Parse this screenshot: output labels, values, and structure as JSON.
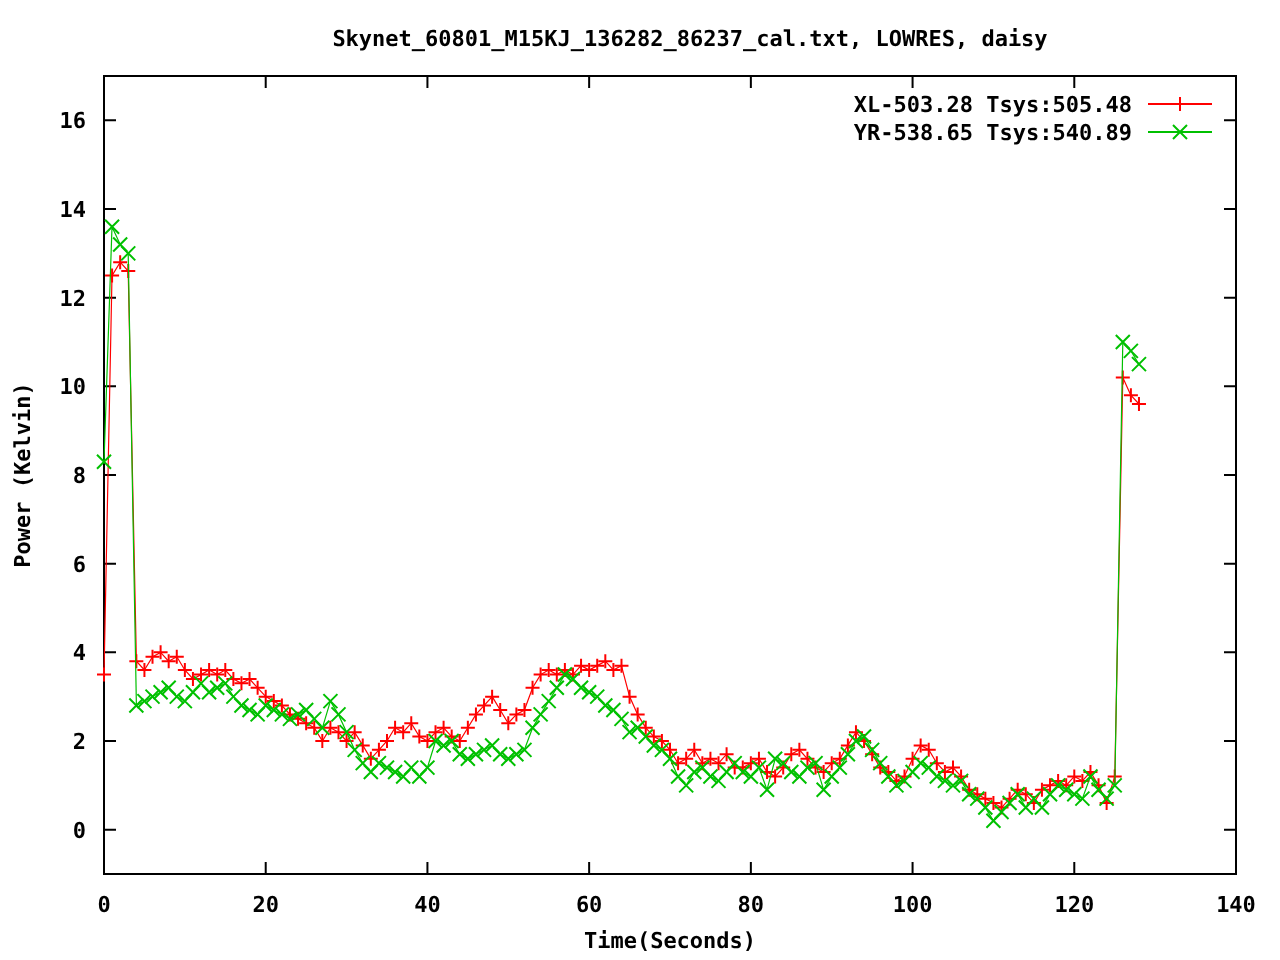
{
  "chart_data": {
    "type": "line",
    "title": "Skynet_60801_M15KJ_136282_86237_cal.txt, LOWRES, daisy",
    "xlabel": "Time(Seconds)",
    "ylabel": "Power (Kelvin)",
    "xlim": [
      0,
      140
    ],
    "ylim": [
      -1,
      17
    ],
    "legend": true,
    "xticks": [
      0,
      20,
      40,
      60,
      80,
      100,
      120,
      140
    ],
    "yticks": [
      0,
      2,
      4,
      6,
      8,
      10,
      12,
      14,
      16
    ],
    "x": [
      0,
      1,
      2,
      3,
      4,
      5,
      6,
      7,
      8,
      9,
      10,
      11,
      12,
      13,
      14,
      15,
      16,
      17,
      18,
      19,
      20,
      21,
      22,
      23,
      24,
      25,
      26,
      27,
      28,
      29,
      30,
      31,
      32,
      33,
      34,
      35,
      36,
      37,
      38,
      39,
      40,
      41,
      42,
      43,
      44,
      45,
      46,
      47,
      48,
      49,
      50,
      51,
      52,
      53,
      54,
      55,
      56,
      57,
      58,
      59,
      60,
      61,
      62,
      63,
      64,
      65,
      66,
      67,
      68,
      69,
      70,
      71,
      72,
      73,
      74,
      75,
      76,
      77,
      78,
      79,
      80,
      81,
      82,
      83,
      84,
      85,
      86,
      87,
      88,
      89,
      90,
      91,
      92,
      93,
      94,
      95,
      96,
      97,
      98,
      99,
      100,
      101,
      102,
      103,
      104,
      105,
      106,
      107,
      108,
      109,
      110,
      111,
      112,
      113,
      114,
      115,
      116,
      117,
      118,
      119,
      120,
      121,
      122,
      123,
      124,
      125,
      126,
      127,
      128
    ],
    "series": [
      {
        "name": "XL-503.28 Tsys:505.48",
        "color": "#ff0000",
        "marker": "plus",
        "values": [
          3.5,
          12.5,
          12.8,
          12.6,
          3.8,
          3.6,
          3.9,
          4.0,
          3.8,
          3.9,
          3.6,
          3.4,
          3.5,
          3.6,
          3.5,
          3.6,
          3.4,
          3.3,
          3.4,
          3.2,
          3.0,
          2.9,
          2.8,
          2.6,
          2.5,
          2.4,
          2.3,
          2.0,
          2.3,
          2.2,
          2.0,
          2.2,
          1.9,
          1.6,
          1.8,
          2.0,
          2.3,
          2.2,
          2.4,
          2.1,
          2.0,
          2.2,
          2.3,
          2.1,
          2.0,
          2.3,
          2.6,
          2.8,
          3.0,
          2.7,
          2.4,
          2.6,
          2.7,
          3.2,
          3.5,
          3.6,
          3.5,
          3.6,
          3.5,
          3.7,
          3.6,
          3.7,
          3.8,
          3.6,
          3.7,
          3.0,
          2.6,
          2.3,
          2.1,
          2.0,
          1.8,
          1.5,
          1.6,
          1.8,
          1.5,
          1.6,
          1.5,
          1.7,
          1.4,
          1.4,
          1.5,
          1.6,
          1.3,
          1.2,
          1.4,
          1.7,
          1.8,
          1.6,
          1.4,
          1.3,
          1.5,
          1.6,
          1.9,
          2.2,
          2.0,
          1.7,
          1.4,
          1.3,
          1.1,
          1.2,
          1.6,
          1.9,
          1.8,
          1.5,
          1.3,
          1.4,
          1.2,
          0.9,
          0.8,
          0.7,
          0.6,
          0.5,
          0.7,
          0.9,
          0.8,
          0.6,
          0.9,
          1.0,
          1.1,
          1.0,
          1.2,
          1.1,
          1.3,
          1.0,
          0.6,
          1.2,
          10.2,
          9.8,
          9.6
        ]
      },
      {
        "name": "YR-538.65 Tsys:540.89",
        "color": "#00c000",
        "marker": "cross",
        "values": [
          8.3,
          13.6,
          13.2,
          13.0,
          2.8,
          2.9,
          3.0,
          3.1,
          3.2,
          3.0,
          2.9,
          3.1,
          3.3,
          3.1,
          3.2,
          3.3,
          3.0,
          2.8,
          2.7,
          2.6,
          2.8,
          2.7,
          2.6,
          2.5,
          2.6,
          2.7,
          2.5,
          2.3,
          2.9,
          2.6,
          2.2,
          1.8,
          1.5,
          1.3,
          1.5,
          1.4,
          1.3,
          1.2,
          1.4,
          1.2,
          1.4,
          2.0,
          1.9,
          2.0,
          1.7,
          1.6,
          1.7,
          1.8,
          1.9,
          1.7,
          1.6,
          1.7,
          1.8,
          2.3,
          2.6,
          2.9,
          3.2,
          3.5,
          3.4,
          3.2,
          3.1,
          3.0,
          2.8,
          2.7,
          2.5,
          2.2,
          2.3,
          2.1,
          1.9,
          1.8,
          1.6,
          1.2,
          1.0,
          1.3,
          1.4,
          1.2,
          1.1,
          1.3,
          1.5,
          1.3,
          1.2,
          1.4,
          0.9,
          1.6,
          1.5,
          1.3,
          1.2,
          1.4,
          1.5,
          0.9,
          1.2,
          1.4,
          1.7,
          2.0,
          2.1,
          1.8,
          1.5,
          1.2,
          1.0,
          1.1,
          1.3,
          1.5,
          1.4,
          1.2,
          1.1,
          1.0,
          1.1,
          0.8,
          0.7,
          0.5,
          0.2,
          0.4,
          0.6,
          0.8,
          0.5,
          0.7,
          0.5,
          0.8,
          1.0,
          0.9,
          0.8,
          0.7,
          1.2,
          0.9,
          0.7,
          1.0,
          11.0,
          10.8,
          10.5
        ]
      }
    ]
  }
}
